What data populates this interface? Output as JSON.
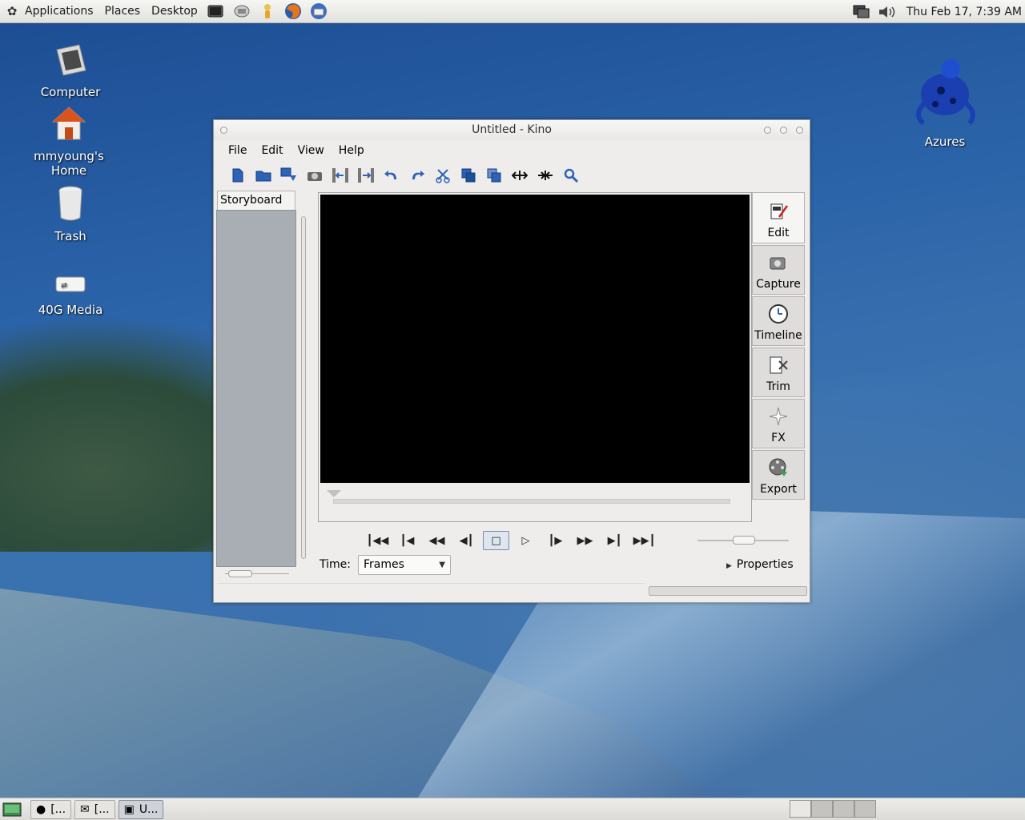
{
  "top_panel": {
    "menus": [
      "Applications",
      "Places",
      "Desktop"
    ],
    "clock": "Thu Feb 17,  7:39 AM",
    "launchers": [
      "terminal-launcher",
      "network-launcher",
      "user-launcher",
      "firefox-launcher",
      "thunderbird-launcher"
    ]
  },
  "desktop_icons": {
    "computer": "Computer",
    "home": "mmyoung's\nHome",
    "home_line1": "mmyoung's",
    "home_line2": "Home",
    "trash": "Trash",
    "media": "40G Media",
    "azures": "Azures"
  },
  "window": {
    "title": "Untitled - Kino",
    "menu": [
      "File",
      "Edit",
      "View",
      "Help"
    ],
    "storyboard_label": "Storyboard",
    "side_tabs": [
      "Edit",
      "Capture",
      "Timeline",
      "Trim",
      "FX",
      "Export"
    ],
    "time_label": "Time:",
    "time_format": "Frames",
    "properties_label": "Properties"
  },
  "bottom_panel": {
    "tasks": [
      "[...",
      "[...",
      "U..."
    ]
  },
  "colors": {
    "accent": "#2e62b8",
    "video_background": "#000000",
    "storyboard_background": "#a9adb4"
  }
}
